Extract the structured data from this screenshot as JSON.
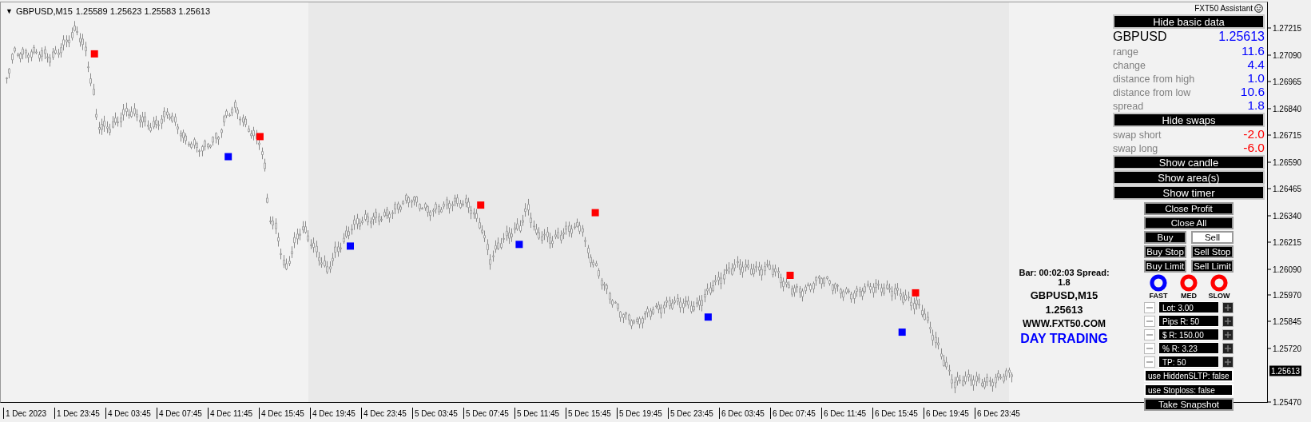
{
  "chart_header": {
    "menu_glyph": "▼",
    "symbol": "GBPUSD,M15",
    "ohlc": [
      "1.25589",
      "1.25623",
      "1.25583",
      "1.25613"
    ]
  },
  "price_axis": {
    "ticks": [
      "1.27215",
      "1.27090",
      "1.26965",
      "1.26840",
      "1.26715",
      "1.26590",
      "1.26465",
      "1.26340",
      "1.26215",
      "1.26090",
      "1.25970",
      "1.25845",
      "1.25720",
      "1.25470"
    ],
    "current_price": "1.25613"
  },
  "time_axis": {
    "labels": [
      "1 Dec 2023",
      "1 Dec 23:45",
      "4 Dec 03:45",
      "4 Dec 07:45",
      "4 Dec 11:45",
      "4 Dec 15:45",
      "4 Dec 19:45",
      "4 Dec 23:45",
      "5 Dec 03:45",
      "5 Dec 07:45",
      "5 Dec 11:45",
      "5 Dec 15:45",
      "5 Dec 19:45",
      "5 Dec 23:45",
      "6 Dec 03:45",
      "6 Dec 07:45",
      "6 Dec 11:45",
      "6 Dec 15:45",
      "6 Dec 19:45",
      "6 Dec 23:45"
    ]
  },
  "assistant_panel": {
    "title": "FXT50 Assistant",
    "rows": [
      {
        "kind": "toggle",
        "label": "Hide basic data"
      },
      {
        "kind": "quote",
        "label": "GBPUSD",
        "value": "1.25613",
        "color": "#0000ff"
      },
      {
        "kind": "stat",
        "label": "range",
        "value": "11.6",
        "color": "#0000ff"
      },
      {
        "kind": "stat",
        "label": "change",
        "value": "4.4",
        "color": "#0000ff"
      },
      {
        "kind": "stat",
        "label": "distance from high",
        "value": "1.0",
        "color": "#0000ff"
      },
      {
        "kind": "stat",
        "label": "distance from low",
        "value": "10.6",
        "color": "#0000ff"
      },
      {
        "kind": "stat",
        "label": "spread",
        "value": "1.8",
        "color": "#0000ff"
      },
      {
        "kind": "toggle",
        "label": "Hide swaps"
      },
      {
        "kind": "stat",
        "label": "swap short",
        "value": "-2.0",
        "color": "#ff0000"
      },
      {
        "kind": "stat",
        "label": "swap long",
        "value": "-6.0",
        "color": "#ff0000"
      },
      {
        "kind": "toggle",
        "label": "Show candle"
      },
      {
        "kind": "toggle",
        "label": "Show area(s)"
      },
      {
        "kind": "toggle",
        "label": "Show timer"
      }
    ]
  },
  "trade_panel": {
    "close_buttons": [
      "Close Profit",
      "Close All"
    ],
    "order_buttons": [
      {
        "label": "Buy",
        "selected": true
      },
      {
        "label": "Sell",
        "selected": false
      }
    ],
    "pending_rows": [
      [
        "Buy Stop",
        "Sell Stop"
      ],
      [
        "Buy Limit",
        "Sell Limit"
      ]
    ],
    "speed_dials": [
      {
        "label": "FAST",
        "color": "#0000ff"
      },
      {
        "label": "MED",
        "color": "#ff0000"
      },
      {
        "label": "SLOW",
        "color": "#ff0000"
      }
    ],
    "steppers": [
      "Lot: 3.00",
      "Pips R: 50",
      "$ R: 150.00",
      "% R: 3.23",
      "TP: 50"
    ],
    "switches": [
      "use HiddenSLTP: false",
      "use Stoploss: false"
    ],
    "snapshot_button": "Take Snapshot"
  },
  "info_overlay": {
    "bar_info": "Bar: 00:02:03 Spread: 1.8",
    "symbol": "GBPUSD,M15",
    "price": "1.25613",
    "website": "WWW.FXT50.COM",
    "tagline": "DAY TRADING"
  }
}
